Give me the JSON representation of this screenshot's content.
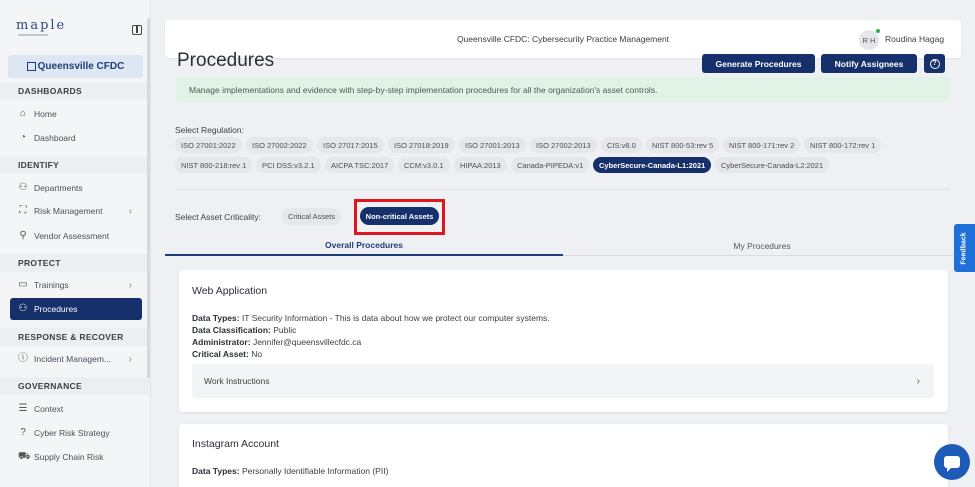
{
  "sidebar": {
    "logo": "maple",
    "org": "Queensville CFDC",
    "sections": [
      "DASHBOARDS",
      "IDENTIFY",
      "PROTECT",
      "RESPONSE & RECOVER",
      "GOVERNANCE"
    ],
    "items": [
      {
        "label": "Home",
        "icon": "home-icon"
      },
      {
        "label": "Dashboard",
        "icon": "gauge-icon"
      },
      {
        "label": "Departments",
        "icon": "org-chart-icon"
      },
      {
        "label": "Risk Management",
        "icon": "risk-icon"
      },
      {
        "label": "Vendor Assessment",
        "icon": "vendor-icon"
      },
      {
        "label": "Trainings",
        "icon": "training-icon"
      },
      {
        "label": "Procedures",
        "icon": "procedures-icon"
      },
      {
        "label": "Incident Managem...",
        "icon": "incident-icon"
      },
      {
        "label": "Context",
        "icon": "context-icon"
      },
      {
        "label": "Cyber Risk Strategy",
        "icon": "strategy-icon"
      },
      {
        "label": "Supply Chain Risk",
        "icon": "supply-chain-icon"
      }
    ]
  },
  "topbar": {
    "title": "Queensville CFDC: Cybersecurity Practice Management",
    "avatar_initials": "R H",
    "user_name": "Roudina Hagag"
  },
  "main": {
    "title": "Procedures",
    "generate_button": "Generate Procedures",
    "notify_button": "Notify Assignees",
    "help_icon": "?",
    "banner": "Manage implementations and evidence with step-by-step implementation procedures for all the organization's asset controls.",
    "regulation_label": "Select Regulation:",
    "regulations_row1": [
      "ISO 27001:2022",
      "ISO 27002:2022",
      "ISO 27017:2015",
      "ISO 27018:2019",
      "ISO 27001:2013",
      "ISO 27002:2013",
      "CIS:v8.0",
      "NIST 800-53:rev 5",
      "NIST 800-171:rev 2",
      "NIST 800-172:rev 1"
    ],
    "regulations_row2": [
      "NIST 800-218:rev 1",
      "PCI DSS:v3.2.1",
      "AICPA TSC:2017",
      "CCM:v3.0.1",
      "HIPAA:2013",
      "Canada-PIPEDA:v1",
      "CyberSecure-Canada-L1:2021",
      "CyberSecure-Canada-L2:2021"
    ],
    "selected_regulation": "CyberSecure-Canada-L1:2021",
    "criticality_label": "Select Asset Criticality:",
    "critical_chip": "Critical Assets",
    "noncritical_chip": "Non-critical Assets",
    "tabs": [
      "Overall Procedures",
      "My Procedures"
    ],
    "cards": [
      {
        "title": "Web Application",
        "data_types_label": "Data Types:",
        "data_types": "IT Security Information - This is data about how we protect our computer systems.",
        "classification_label": "Data Classification:",
        "classification": "Public",
        "admin_label": "Administrator:",
        "admin": "Jennifer@queensvillecfdc.ca",
        "critical_label": "Critical Asset:",
        "critical": "No",
        "work_instructions": "Work Instructions"
      },
      {
        "title": "Instagram Account",
        "data_types_label": "Data Types:",
        "data_types": "Personally Identifiable Information (PII)"
      }
    ]
  },
  "feedback": "Feedback",
  "colors": {
    "primary": "#15306b",
    "banner": "#e1f2e6",
    "highlight": "#e0161e",
    "feedback": "#1e6fd9"
  }
}
